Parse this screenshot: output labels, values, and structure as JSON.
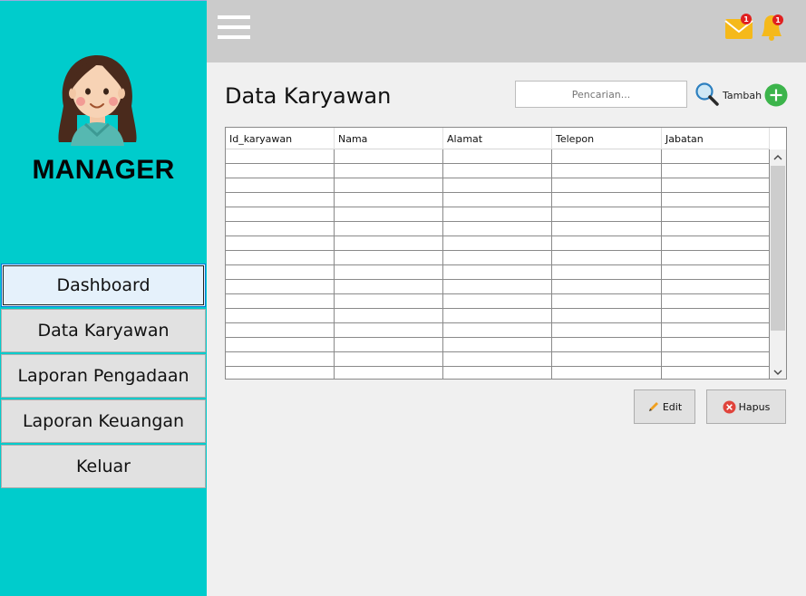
{
  "sidebar": {
    "role_title": "MANAGER",
    "nav": [
      {
        "label": "Dashboard",
        "active": true
      },
      {
        "label": "Data Karyawan",
        "active": false
      },
      {
        "label": "Laporan Pengadaan",
        "active": false
      },
      {
        "label": "Laporan Keuangan",
        "active": false
      },
      {
        "label": "Keluar",
        "active": false
      }
    ]
  },
  "topbar": {
    "menu_icon": "hamburger-icon",
    "mail_badge": "1",
    "bell_badge": "1"
  },
  "main": {
    "title": "Data Karyawan",
    "search": {
      "placeholder": "Pencarian...",
      "value": ""
    },
    "add_label": "Tambah",
    "table": {
      "columns": [
        "Id_karyawan",
        "Nama",
        "Alamat",
        "Telepon",
        "Jabatan"
      ],
      "rows": []
    },
    "edit_label": "Edit",
    "delete_label": "Hapus"
  },
  "colors": {
    "sidebar_bg": "#00cccc",
    "topbar_bg": "#cbcbcb",
    "content_bg": "#f0f0f0",
    "add_icon": "#3cb44b",
    "delete_icon": "#e0443c",
    "badge": "#e02020"
  }
}
